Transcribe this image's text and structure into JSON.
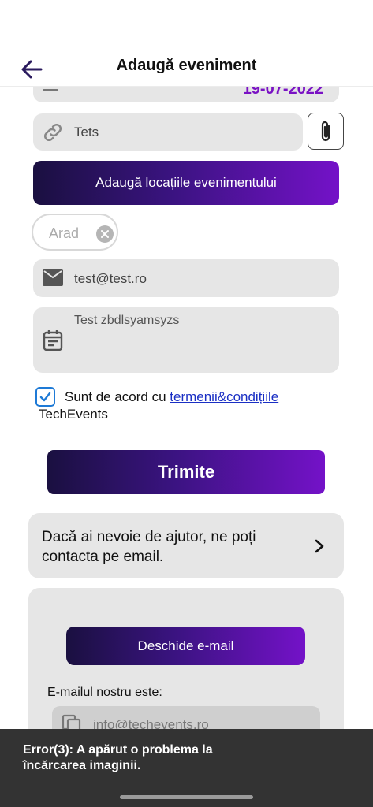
{
  "header": {
    "title": "Adaugă eveniment"
  },
  "form": {
    "date_value": "19-07-2022",
    "link_value": "Tets",
    "add_locations_label": "Adaugă locațiile evenimentului",
    "location_chip": "Arad",
    "email_value": "test@test.ro",
    "description_value": "Test zbdlsyamsyzs",
    "terms_prefix": "Sunt de acord cu ",
    "terms_link": "termenii&condițiile",
    "terms_suffix": "TechEvents",
    "terms_checked": true,
    "submit_label": "Trimite"
  },
  "help": {
    "text": "Dacă ai nevoie de ajutor, ne poți contacta pe email.",
    "open_email_label": "Deschide e-mail",
    "our_email_label": "E-mailul nostru este:",
    "contact_email": "info@techevents.ro"
  },
  "snackbar": {
    "message": "Error(3): A apărut o problema la încărcarea imaginii."
  },
  "colors": {
    "accent_purple": "#7412c8",
    "gradient_dark": "#1a1040",
    "date_text": "#7a12c4",
    "link_blue": "#1a2fc4",
    "field_bg": "#e6e6e6",
    "snackbar_bg": "#333333"
  },
  "icons": {
    "back": "arrow-left-icon",
    "link": "link-icon",
    "attach": "paperclip-icon",
    "chip_remove": "close-circle-icon",
    "email": "envelope-icon",
    "description": "calendar-icon",
    "checkbox": "check-icon",
    "help": "chevron-right-icon",
    "copy": "copy-icon"
  }
}
